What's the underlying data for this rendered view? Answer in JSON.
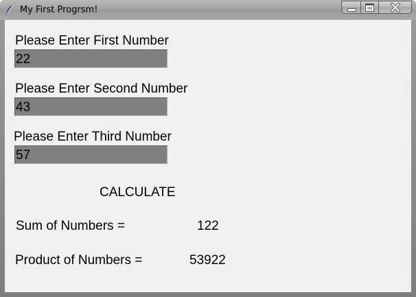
{
  "window": {
    "title": "My First Progrsm!",
    "icon": "feather-icon",
    "controls": [
      "minimize-icon",
      "maximize-icon",
      "close-icon"
    ]
  },
  "form": {
    "first": {
      "label": "Please Enter First Number",
      "value": "22"
    },
    "second": {
      "label": "Please Enter Second Number",
      "value": "43"
    },
    "third": {
      "label": "Please Enter Third Number",
      "value": "57"
    },
    "calculate_label": "CALCULATE"
  },
  "results": {
    "sum_label": "Sum of Numbers =",
    "sum_value": "122",
    "product_label": "Product of Numbers =",
    "product_value": "53922"
  },
  "colors": {
    "entry_background": "#808080",
    "client_background": "#f0f0f0"
  }
}
